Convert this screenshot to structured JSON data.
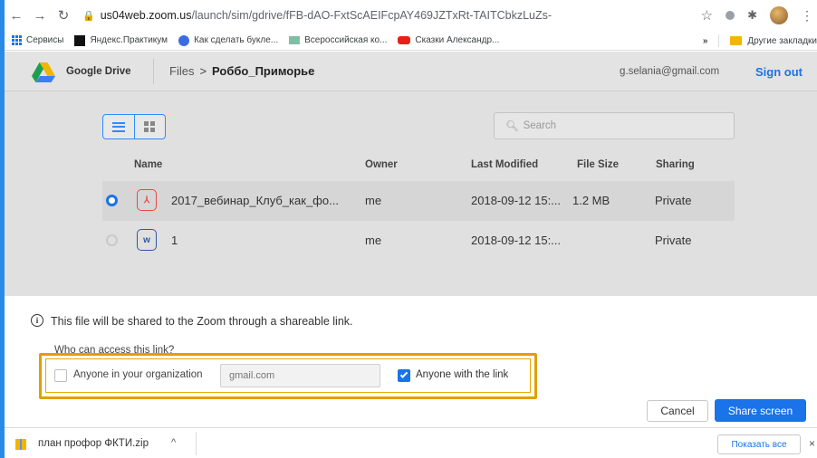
{
  "browser": {
    "url_host": "us04web.zoom.us",
    "url_path": "/launch/sim/gdrive/fFB-dAO-FxtScAEIFcpAY469JZTxRt-TAITCbkzLuZs-",
    "bookmarks": [
      {
        "label": "Сервисы",
        "icon": "apps-grid-icon"
      },
      {
        "label": "Яндекс.Практикум",
        "icon": "yandex-icon"
      },
      {
        "label": "Как сделать букле...",
        "icon": "c-icon"
      },
      {
        "label": "Всероссийская ко...",
        "icon": "mail-icon"
      },
      {
        "label": "Сказки Александр...",
        "icon": "youtube-icon"
      }
    ],
    "bookmarks_more": "»",
    "other_bookmarks": "Другие закладки"
  },
  "header": {
    "app_title": "Google Drive",
    "breadcrumb_root": "Files",
    "breadcrumb_sep": ">",
    "breadcrumb_current": "Роббо_Приморье",
    "email": "g.selania@gmail.com",
    "sign_out": "Sign out"
  },
  "search": {
    "placeholder": "Search"
  },
  "table": {
    "columns": {
      "name": "Name",
      "owner": "Owner",
      "modified": "Last Modified",
      "size": "File Size",
      "sharing": "Sharing"
    },
    "rows": [
      {
        "name": "2017_вебинар_Клуб_как_фо...",
        "owner": "me",
        "modified": "2018-09-12 15:...",
        "size": "1.2 MB",
        "sharing": "Private",
        "type_icon": "pdf-icon",
        "selected": true
      },
      {
        "name": "1",
        "owner": "me",
        "modified": "2018-09-12 15:...",
        "size": "",
        "sharing": "Private",
        "type_icon": "word-icon",
        "selected": false
      }
    ]
  },
  "share": {
    "info": "This file will be shared to the Zoom through a shareable link.",
    "who_label": "Who can access this link?",
    "org_option": "Anyone in your organization",
    "org_checked": false,
    "domain_placeholder": "gmail.com",
    "link_option": "Anyone with the link",
    "link_checked": true,
    "cancel": "Cancel",
    "share_button": "Share screen"
  },
  "downloads": {
    "file": "план профор ФКТИ.zip",
    "caret": "^",
    "show_all": "Показать все",
    "close": "×"
  },
  "colors": {
    "accent": "#1a73e8",
    "highlight": "#e0a000"
  }
}
